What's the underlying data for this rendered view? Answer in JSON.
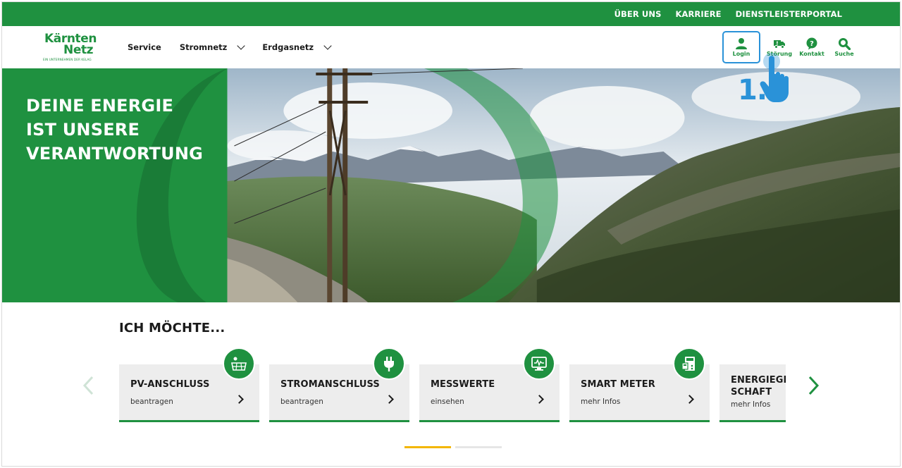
{
  "colors": {
    "brand_green": "#1f9140",
    "highlight_blue": "#2a92d8",
    "pager_active": "#f3b600"
  },
  "topbar": {
    "links": [
      "ÜBER UNS",
      "KARRIERE",
      "DIENSTLEISTERPORTAL"
    ]
  },
  "logo": {
    "line1": "Kärnten",
    "line2": "Netz",
    "tagline": "EIN UNTERNEHMEN DER KELAG"
  },
  "nav": {
    "items": [
      "Service",
      "Stromnetz",
      "Erdgasnetz"
    ]
  },
  "tools": {
    "login": "Login",
    "stoerung": "Störung",
    "kontakt": "Kontakt",
    "suche": "Suche"
  },
  "hero": {
    "line1": "DEINE ENERGIE",
    "line2": "IST UNSERE",
    "line3": "VERANTWORTUNG",
    "step_label": "1."
  },
  "section": {
    "title": "ICH MÖCHTE..."
  },
  "cards": [
    {
      "title": "PV-ANSCHLUSS",
      "sub": "beantragen",
      "icon": "solar-panel-icon"
    },
    {
      "title": "STROMANSCHLUSS",
      "sub": "beantragen",
      "icon": "plug-icon"
    },
    {
      "title": "MESSWERTE",
      "sub": "einsehen",
      "icon": "monitor-chart-icon"
    },
    {
      "title": "SMART METER",
      "sub": "mehr Infos",
      "icon": "smart-meter-icon"
    },
    {
      "title_line1": "ENERGIEGE",
      "title_line2": "SCHAFT",
      "sub": "mehr Infos"
    }
  ],
  "pager": {
    "pages": 2,
    "active": 1
  }
}
